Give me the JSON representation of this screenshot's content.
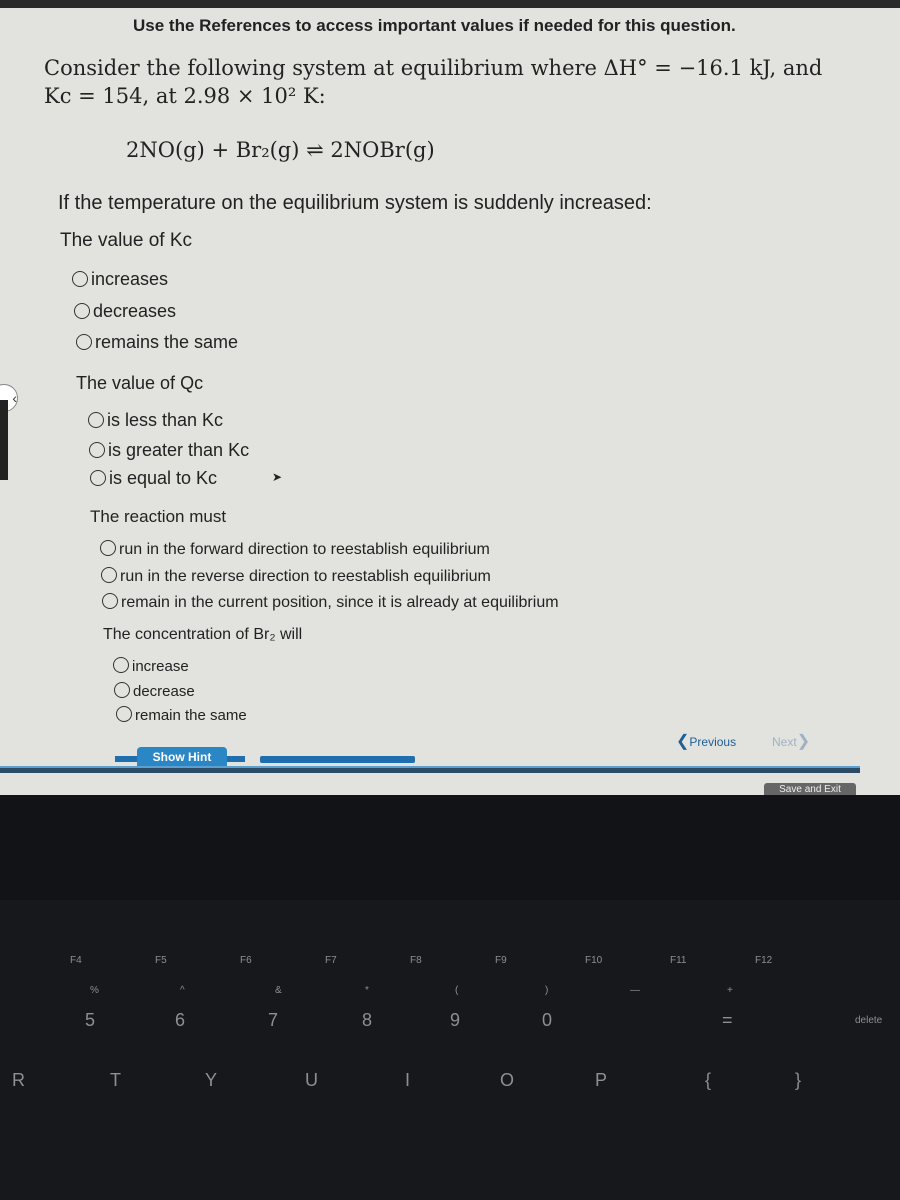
{
  "header": {
    "references": "Use the References to access important values if needed for this question."
  },
  "question": {
    "intro_line1": "Consider the following system at equilibrium where ΔH° = −16.1 kJ, and",
    "intro_line2": "Kc = 154, at 2.98 × 10² K:",
    "equation": "2NO(g) + Br₂(g) ⇌ 2NOBr(g)",
    "condition": "If the temperature on the equilibrium system is suddenly increased:"
  },
  "parts": [
    {
      "label": "The value of Kc",
      "options": [
        "increases",
        "decreases",
        "remains the same"
      ]
    },
    {
      "label": "The value of Qc",
      "options": [
        "is less than Kc",
        "is greater than Kc",
        "is equal to Kc"
      ]
    },
    {
      "label": "The reaction must",
      "options": [
        "run in the forward direction to reestablish equilibrium",
        "run in the reverse direction to reestablish equilibrium",
        "remain in the current position, since it is already at equilibrium"
      ]
    },
    {
      "label": "The concentration of Br₂ will",
      "options": [
        "increase",
        "decrease",
        "remain the same"
      ]
    }
  ],
  "footer": {
    "show_hint": "Show Hint",
    "previous": "Previous",
    "next": "Next",
    "save_exit": "Save and Exit"
  },
  "keyboard": {
    "fkeys": [
      "F4",
      "F5",
      "F6",
      "F7",
      "F8",
      "F9",
      "F10",
      "F11",
      "F12"
    ],
    "numbers": [
      "5",
      "6",
      "7",
      "8",
      "9",
      "0",
      "="
    ],
    "symbols": [
      "%",
      "^",
      "&",
      "*",
      "(",
      ")",
      "—",
      "+"
    ],
    "letters": [
      "R",
      "T",
      "Y",
      "U",
      "I",
      "O",
      "P",
      "{",
      "}"
    ],
    "delete": "delete"
  },
  "colors": {
    "accent": "#2b86c6",
    "screen_bg": "#e2e2df"
  }
}
